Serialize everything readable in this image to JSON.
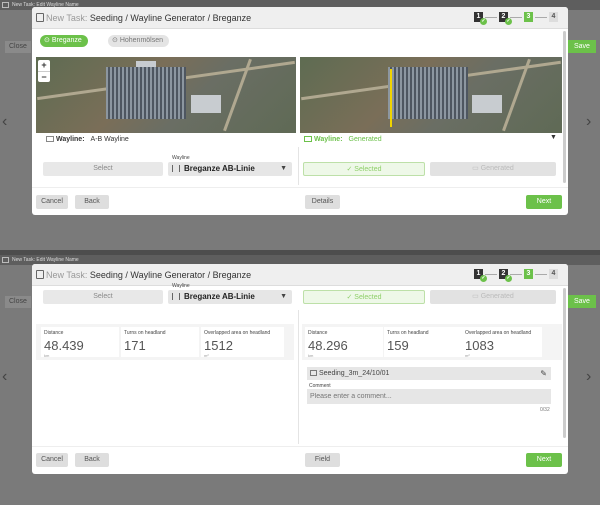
{
  "top_strip": "New Task: Edit Wayline Name",
  "side": {
    "close_label": "Close",
    "save_label": "Save",
    "prev_arrow": "‹",
    "next_arrow": "›"
  },
  "dialog": {
    "title_prefix": "New Task:",
    "title": "Seeding / Wayline Generator / Breganze",
    "steps": [
      "1",
      "2",
      "3",
      "4"
    ]
  },
  "farm_chips": [
    "Breganze",
    "Hohenmölsen"
  ],
  "map_zoom": {
    "in": "+",
    "out": "−"
  },
  "left": {
    "wayline_label": "Wayline:",
    "wayline_value": "A-B Wayline",
    "select_label": "Select",
    "select_title": "Wayline",
    "select_value": "Breganze AB-Linie",
    "stats": [
      {
        "label": "Distance",
        "value": "48.439",
        "unit": "km"
      },
      {
        "label": "Turns on headland",
        "value": "171",
        "unit": ""
      },
      {
        "label": "Overlapped area on headland",
        "value": "1512",
        "unit": "m²"
      }
    ]
  },
  "right": {
    "wayline_label": "Wayline:",
    "wayline_value": "Generated",
    "selected_label": "Selected",
    "generated_label": "Generated",
    "dropdown": "▼",
    "stats": [
      {
        "label": "Distance",
        "value": "48.296",
        "unit": "km"
      },
      {
        "label": "Turns on headland",
        "value": "159",
        "unit": ""
      },
      {
        "label": "Overlapped area on headland",
        "value": "1083",
        "unit": "m²"
      }
    ],
    "seeding_name": "Seeding_3m_24/10/01",
    "comment_label": "Comment",
    "comment_placeholder": "Please enter a comment...",
    "comment_count": "0/32"
  },
  "footer1": {
    "cancel": "Cancel",
    "back": "Back",
    "details": "Details",
    "next": "Next"
  },
  "footer2": {
    "cancel": "Cancel",
    "back": "Back",
    "field": "Field",
    "next": "Next"
  },
  "colors": {
    "accent": "#6cc14a",
    "wayline": "#f0d400"
  }
}
